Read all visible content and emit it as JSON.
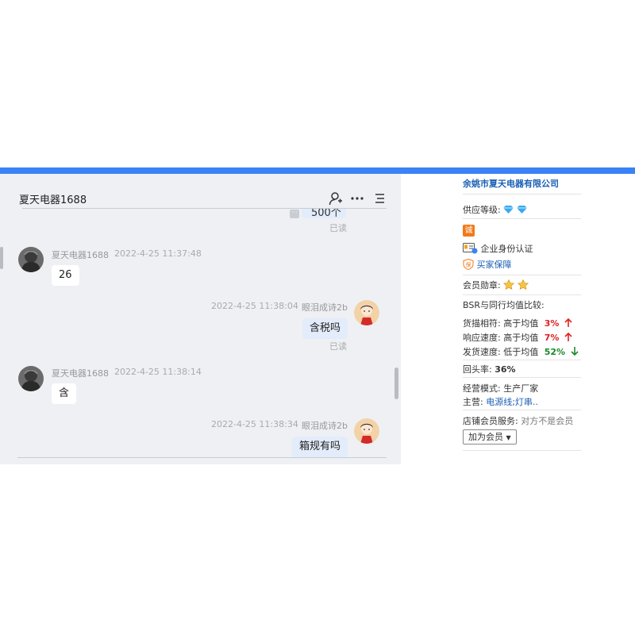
{
  "chat": {
    "title": "夏天电器1688",
    "partial_message": "500个",
    "partial_read": "已读",
    "messages": [
      {
        "side": "in",
        "name": "夏天电器1688",
        "time": "2022-4-25 11:37:48",
        "text": "26"
      },
      {
        "side": "out",
        "name": "眼泪成诗2b",
        "time": "2022-4-25 11:38:04",
        "text": "含税吗",
        "status": "已读"
      },
      {
        "side": "in",
        "name": "夏天电器1688",
        "time": "2022-4-25 11:38:14",
        "text": "含"
      },
      {
        "side": "out",
        "name": "眼泪成诗2b",
        "time": "2022-4-25 11:38:34",
        "text": "箱规有吗"
      }
    ],
    "icons": [
      "person-add-icon",
      "more-dots-icon",
      "menu-list-icon"
    ]
  },
  "info": {
    "company": "余姚市夏天电器有限公司",
    "supply_level_label": "供应等级:",
    "cheng_badge": "诚",
    "verify_label": "企业身份认证",
    "buyer_protect_label": "买家保障",
    "badge_label": "会员勋章:",
    "bsr_label": "BSR与同行均值比较:",
    "metrics": [
      {
        "label": "货描相符:",
        "compare": "高于均值",
        "value": "3%",
        "dir": "up"
      },
      {
        "label": "响应速度:",
        "compare": "高于均值",
        "value": "7%",
        "dir": "up"
      },
      {
        "label": "发货速度:",
        "compare": "低于均值",
        "value": "52%",
        "dir": "down"
      }
    ],
    "repeat_label": "回头率:",
    "repeat_value": "36%",
    "mode_label": "经营模式:",
    "mode_value": "生产厂家",
    "main_label": "主营:",
    "main_value": "电源线;灯串..",
    "service_label": "店铺会员服务:",
    "service_value": "对方不是会员",
    "join_button": "加为会员",
    "colors": {
      "accent": "#3a82f7",
      "link": "#1a5fb4",
      "up": "#e02020",
      "down": "#1a8a2a"
    }
  }
}
